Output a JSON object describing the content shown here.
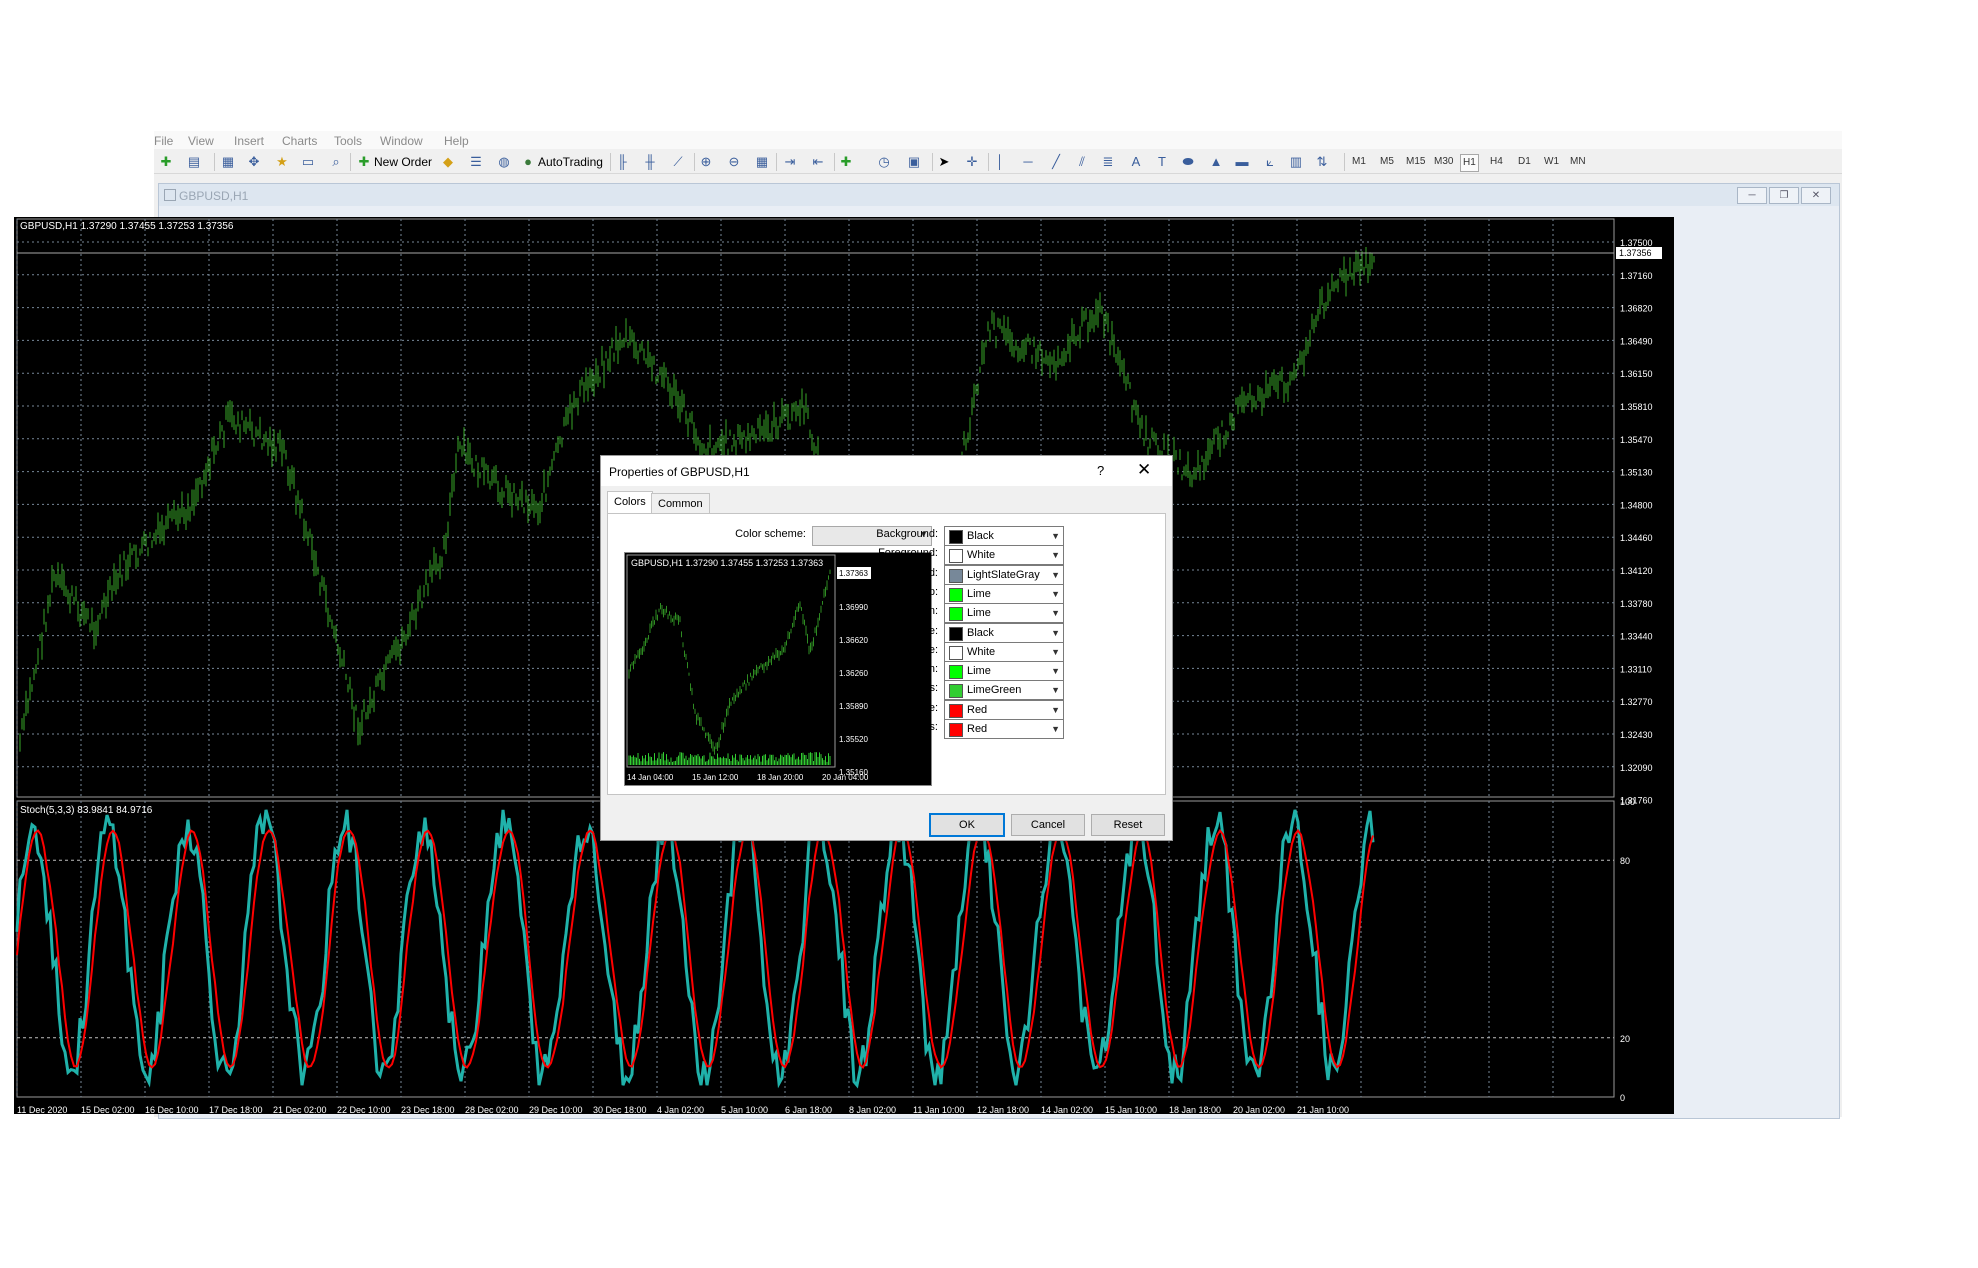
{
  "menu": [
    "File",
    "View",
    "Insert",
    "Charts",
    "Tools",
    "Window",
    "Help"
  ],
  "toolbar": {
    "new_order": "New Order",
    "autotrading": "AutoTrading",
    "timeframes": [
      "M1",
      "M5",
      "M15",
      "M30",
      "H1",
      "H4",
      "D1",
      "W1",
      "MN"
    ],
    "active_timeframe": "H1"
  },
  "chart_window": {
    "title": "GBPUSD,H1",
    "header": "GBPUSD,H1  1.37290 1.37455 1.37253 1.37356",
    "current_price": "1.37356",
    "price_scale": [
      "1.37500",
      "1.37160",
      "1.36820",
      "1.36490",
      "1.36150",
      "1.35810",
      "1.35470",
      "1.35130",
      "1.34800",
      "1.34460",
      "1.34120",
      "1.33780",
      "1.33440",
      "1.33110",
      "1.32770",
      "1.32430",
      "1.32090",
      "1.31760"
    ],
    "indicator_label": "Stoch(5,3,3) 83.9841 84.9716",
    "indicator_scale": [
      "100",
      "80",
      "20",
      "0"
    ],
    "time_axis": [
      "11 Dec 2020",
      "15 Dec 02:00",
      "16 Dec 10:00",
      "17 Dec 18:00",
      "21 Dec 02:00",
      "22 Dec 10:00",
      "23 Dec 18:00",
      "28 Dec 02:00",
      "29 Dec 10:00",
      "30 Dec 18:00",
      "4 Jan 02:00",
      "5 Jan 10:00",
      "6 Jan 18:00",
      "8 Jan 02:00",
      "11 Jan 10:00",
      "12 Jan 18:00",
      "14 Jan 02:00",
      "15 Jan 10:00",
      "18 Jan 18:00",
      "20 Jan 02:00",
      "21 Jan 10:00"
    ]
  },
  "dialog": {
    "title": "Properties of GBPUSD,H1",
    "help": "?",
    "tabs": [
      "Colors",
      "Common"
    ],
    "color_scheme_label": "Color scheme:",
    "color_scheme_value": "",
    "preview": {
      "header": "GBPUSD,H1  1.37290 1.37455 1.37253 1.37363",
      "current_price": "1.37363",
      "price_scale": [
        "1.36990",
        "1.36620",
        "1.36260",
        "1.35890",
        "1.35520",
        "1.35160"
      ],
      "time_axis": [
        "14 Jan 04:00",
        "15 Jan 12:00",
        "18 Jan 20:00",
        "20 Jan 04:00"
      ]
    },
    "properties": [
      {
        "label": "Background:",
        "value": "Black",
        "color": "#000000"
      },
      {
        "label": "Foreground:",
        "value": "White",
        "color": "#ffffff"
      },
      {
        "label": "Grid:",
        "value": "LightSlateGray",
        "color": "#778899"
      },
      {
        "label": "Bar Up:",
        "value": "Lime",
        "color": "#00ff00"
      },
      {
        "label": "Bar Down:",
        "value": "Lime",
        "color": "#00ff00"
      },
      {
        "label": "Bull candle:",
        "value": "Black",
        "color": "#000000"
      },
      {
        "label": "Bear candle:",
        "value": "White",
        "color": "#ffffff"
      },
      {
        "label": "Line graph:",
        "value": "Lime",
        "color": "#00ff00"
      },
      {
        "label": "Volumes:",
        "value": "LimeGreen",
        "color": "#32cd32"
      },
      {
        "label": "Ask line:",
        "value": "Red",
        "color": "#ff0000"
      },
      {
        "label": "Stop levels:",
        "value": "Red",
        "color": "#ff0000"
      }
    ],
    "buttons": {
      "ok": "OK",
      "cancel": "Cancel",
      "reset": "Reset"
    }
  },
  "colors": {
    "bar": "#2e8b22",
    "stoch_main": "#20b2aa",
    "stoch_signal": "#ff0000",
    "grid": "#778899"
  }
}
